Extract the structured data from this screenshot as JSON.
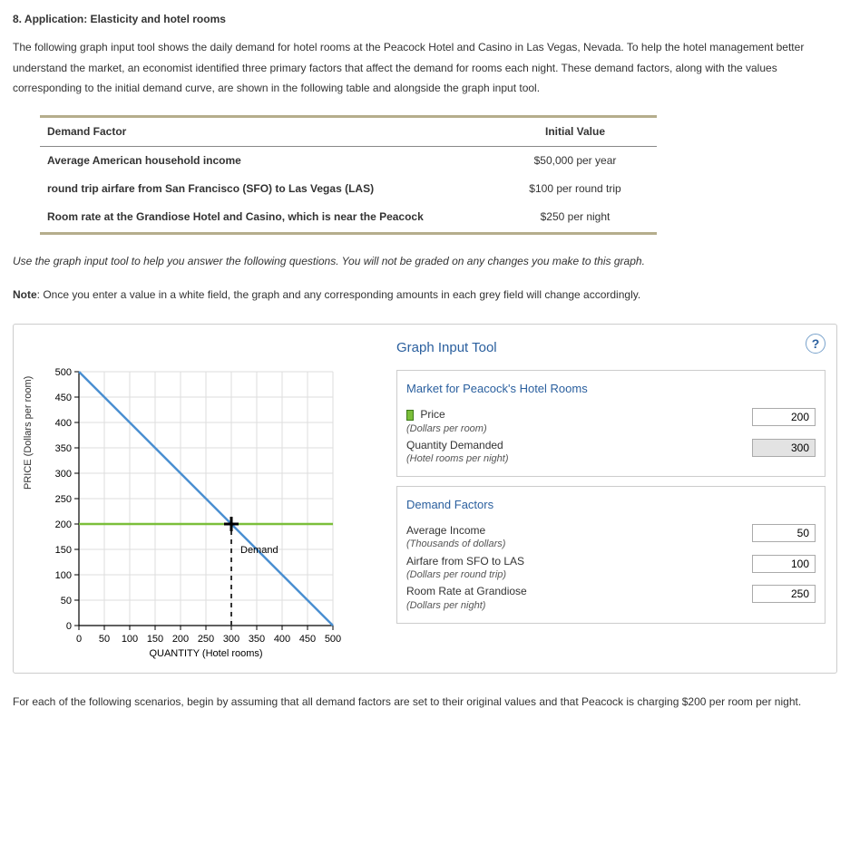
{
  "header": {
    "title": "8. Application: Elasticity and hotel rooms"
  },
  "intro_paragraph": "The following graph input tool shows the daily demand for hotel rooms at the Peacock Hotel and Casino in Las Vegas, Nevada. To help the hotel management better understand the market, an economist identified three primary factors that affect the demand for rooms each night. These demand factors, along with the values corresponding to the initial demand curve, are shown in the following table and alongside the graph input tool.",
  "factor_table": {
    "col1_header": "Demand Factor",
    "col2_header": "Initial Value",
    "rows": [
      {
        "factor": "Average American household income",
        "value": "$50,000 per year"
      },
      {
        "factor": "round trip airfare from San Francisco (SFO) to Las Vegas (LAS)",
        "value": "$100 per round trip"
      },
      {
        "factor": "Room rate at the Grandiose Hotel and Casino, which is near the Peacock",
        "value": "$250 per night"
      }
    ]
  },
  "instruction_italic": "Use the graph input tool to help you answer the following questions. You will not be graded on any changes you make to this graph.",
  "note_label": "Note",
  "note_text": ": Once you enter a value in a white field, the graph and any corresponding amounts in each grey field will change accordingly.",
  "tool": {
    "title": "Graph Input Tool",
    "help_glyph": "?",
    "market_title": "Market for Peacock's Hotel Rooms",
    "price_label": "Price",
    "price_sub": "(Dollars per room)",
    "price_value": "200",
    "qty_label": "Quantity Demanded",
    "qty_sub": "(Hotel rooms per night)",
    "qty_value": "300",
    "factors_title": "Demand Factors",
    "income_label": "Average Income",
    "income_sub": "(Thousands of dollars)",
    "income_value": "50",
    "airfare_label": "Airfare from SFO to LAS",
    "airfare_sub": "(Dollars per round trip)",
    "airfare_value": "100",
    "grandiose_label": "Room Rate at Grandiose",
    "grandiose_sub": "(Dollars per night)",
    "grandiose_value": "250"
  },
  "chart_data": {
    "type": "line",
    "title": "",
    "xlabel": "QUANTITY (Hotel rooms)",
    "ylabel": "PRICE (Dollars per room)",
    "xlim": [
      0,
      500
    ],
    "ylim": [
      0,
      500
    ],
    "x_ticks": [
      0,
      50,
      100,
      150,
      200,
      250,
      300,
      350,
      400,
      450,
      500
    ],
    "y_ticks": [
      0,
      50,
      100,
      150,
      200,
      250,
      300,
      350,
      400,
      450,
      500
    ],
    "series": [
      {
        "name": "Demand",
        "color": "#4a8fd1",
        "points": [
          [
            0,
            500
          ],
          [
            500,
            0
          ]
        ]
      }
    ],
    "reference_lines": {
      "horizontal": {
        "y": 200,
        "color": "#7bbf3a"
      },
      "vertical_dashed": {
        "x": 300,
        "from_y": 0,
        "to_y": 200,
        "color": "#333"
      }
    },
    "marker": {
      "x": 300,
      "y": 200
    },
    "annotations": [
      {
        "text": "Demand",
        "x": 300,
        "y": 150
      }
    ]
  },
  "footer_paragraph": "For each of the following scenarios, begin by assuming that all demand factors are set to their original values and that Peacock is charging $200 per room per night."
}
